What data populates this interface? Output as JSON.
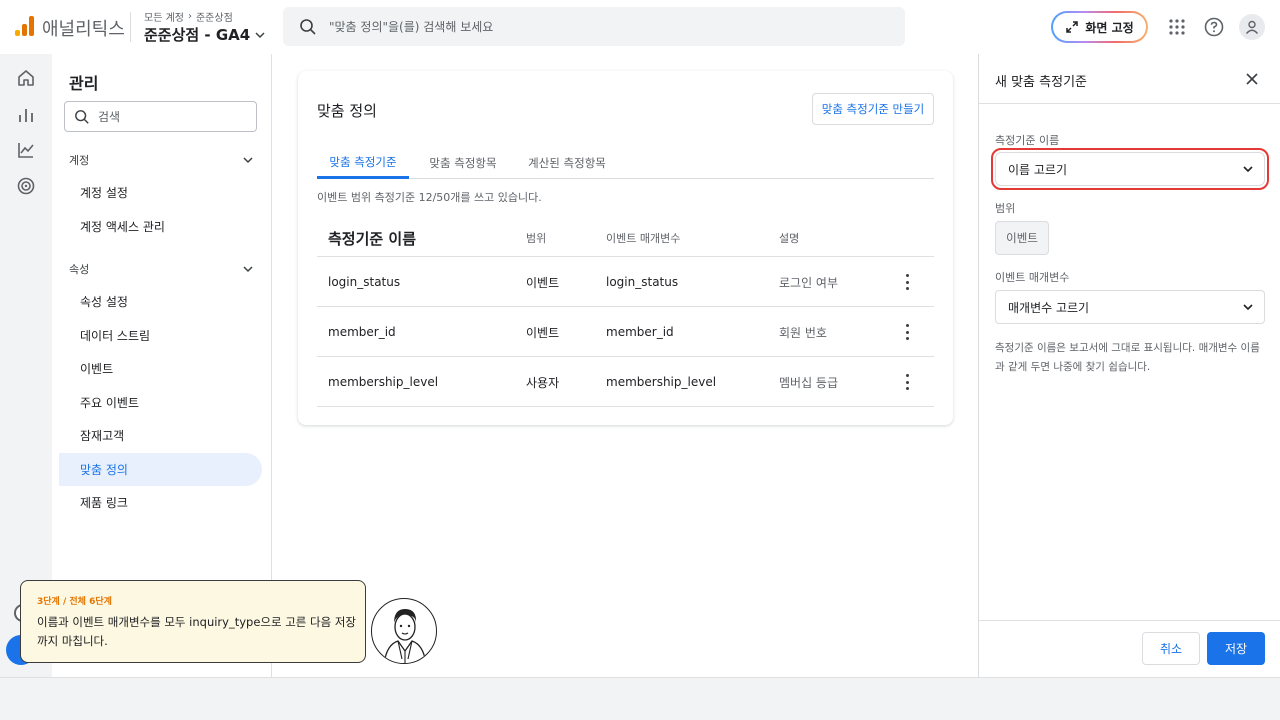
{
  "app": {
    "name": "애널리틱스",
    "breadcrumb": [
      "모든 계정",
      "준준상점"
    ],
    "property_name": "준준상점 - GA4",
    "search_placeholder": "\"맞춤 정의\"을(를) 검색해 보세요",
    "fix_screen_label": "화면 고정",
    "logo_colors": [
      "#f9ab00",
      "#e37400",
      "#e37400"
    ]
  },
  "sidebar": {
    "title": "관리",
    "search_placeholder": "검색",
    "account_section": "계정",
    "account_items": [
      "계정 설정",
      "계정 액세스 관리"
    ],
    "property_section": "속성",
    "property_items": [
      "속성 설정",
      "데이터 스트림",
      "이벤트",
      "주요 이벤트",
      "잠재고객",
      "맞춤 정의",
      "제품 링크"
    ],
    "active_item": "맞춤 정의"
  },
  "main": {
    "title": "맞춤 정의",
    "create_button": "맞춤 측정기준 만들기",
    "tabs": [
      "맞춤 측정기준",
      "맞춤 측정항목",
      "계산된 측정항목"
    ],
    "active_tab": 0,
    "usage_text": "이벤트 범위 측정기준 12/50개를 쓰고 있습니다.",
    "columns": [
      "측정기준 이름",
      "범위",
      "이벤트 매개변수",
      "설명"
    ],
    "rows": [
      {
        "name": "login_status",
        "scope": "이벤트",
        "param": "login_status",
        "desc": "로그인 여부"
      },
      {
        "name": "member_id",
        "scope": "이벤트",
        "param": "member_id",
        "desc": "회원 번호"
      },
      {
        "name": "membership_level",
        "scope": "사용자",
        "param": "membership_level",
        "desc": "멤버십 등급"
      }
    ]
  },
  "panel": {
    "title": "새 맞춤 측정기준",
    "name_label": "측정기준 이름",
    "name_value": "이름 고르기",
    "scope_label": "범위",
    "scope_value": "이벤트",
    "param_label": "이벤트 매개변수",
    "param_value": "매개변수 고르기",
    "hint": "측정기준 이름은 보고서에 그대로 표시됩니다. 매개변수 이름과 같게 두면 나중에 찾기 쉽습니다.",
    "cancel": "취소",
    "save": "저장",
    "accent": "#1a73e8",
    "highlight_color": "#e53935"
  },
  "guide": {
    "step": "3단계 / 전체 6단계",
    "text": "이름과 이벤트 매개변수를 모두 inquiry_type으로 고른 다음 저장까지 마칩니다."
  }
}
